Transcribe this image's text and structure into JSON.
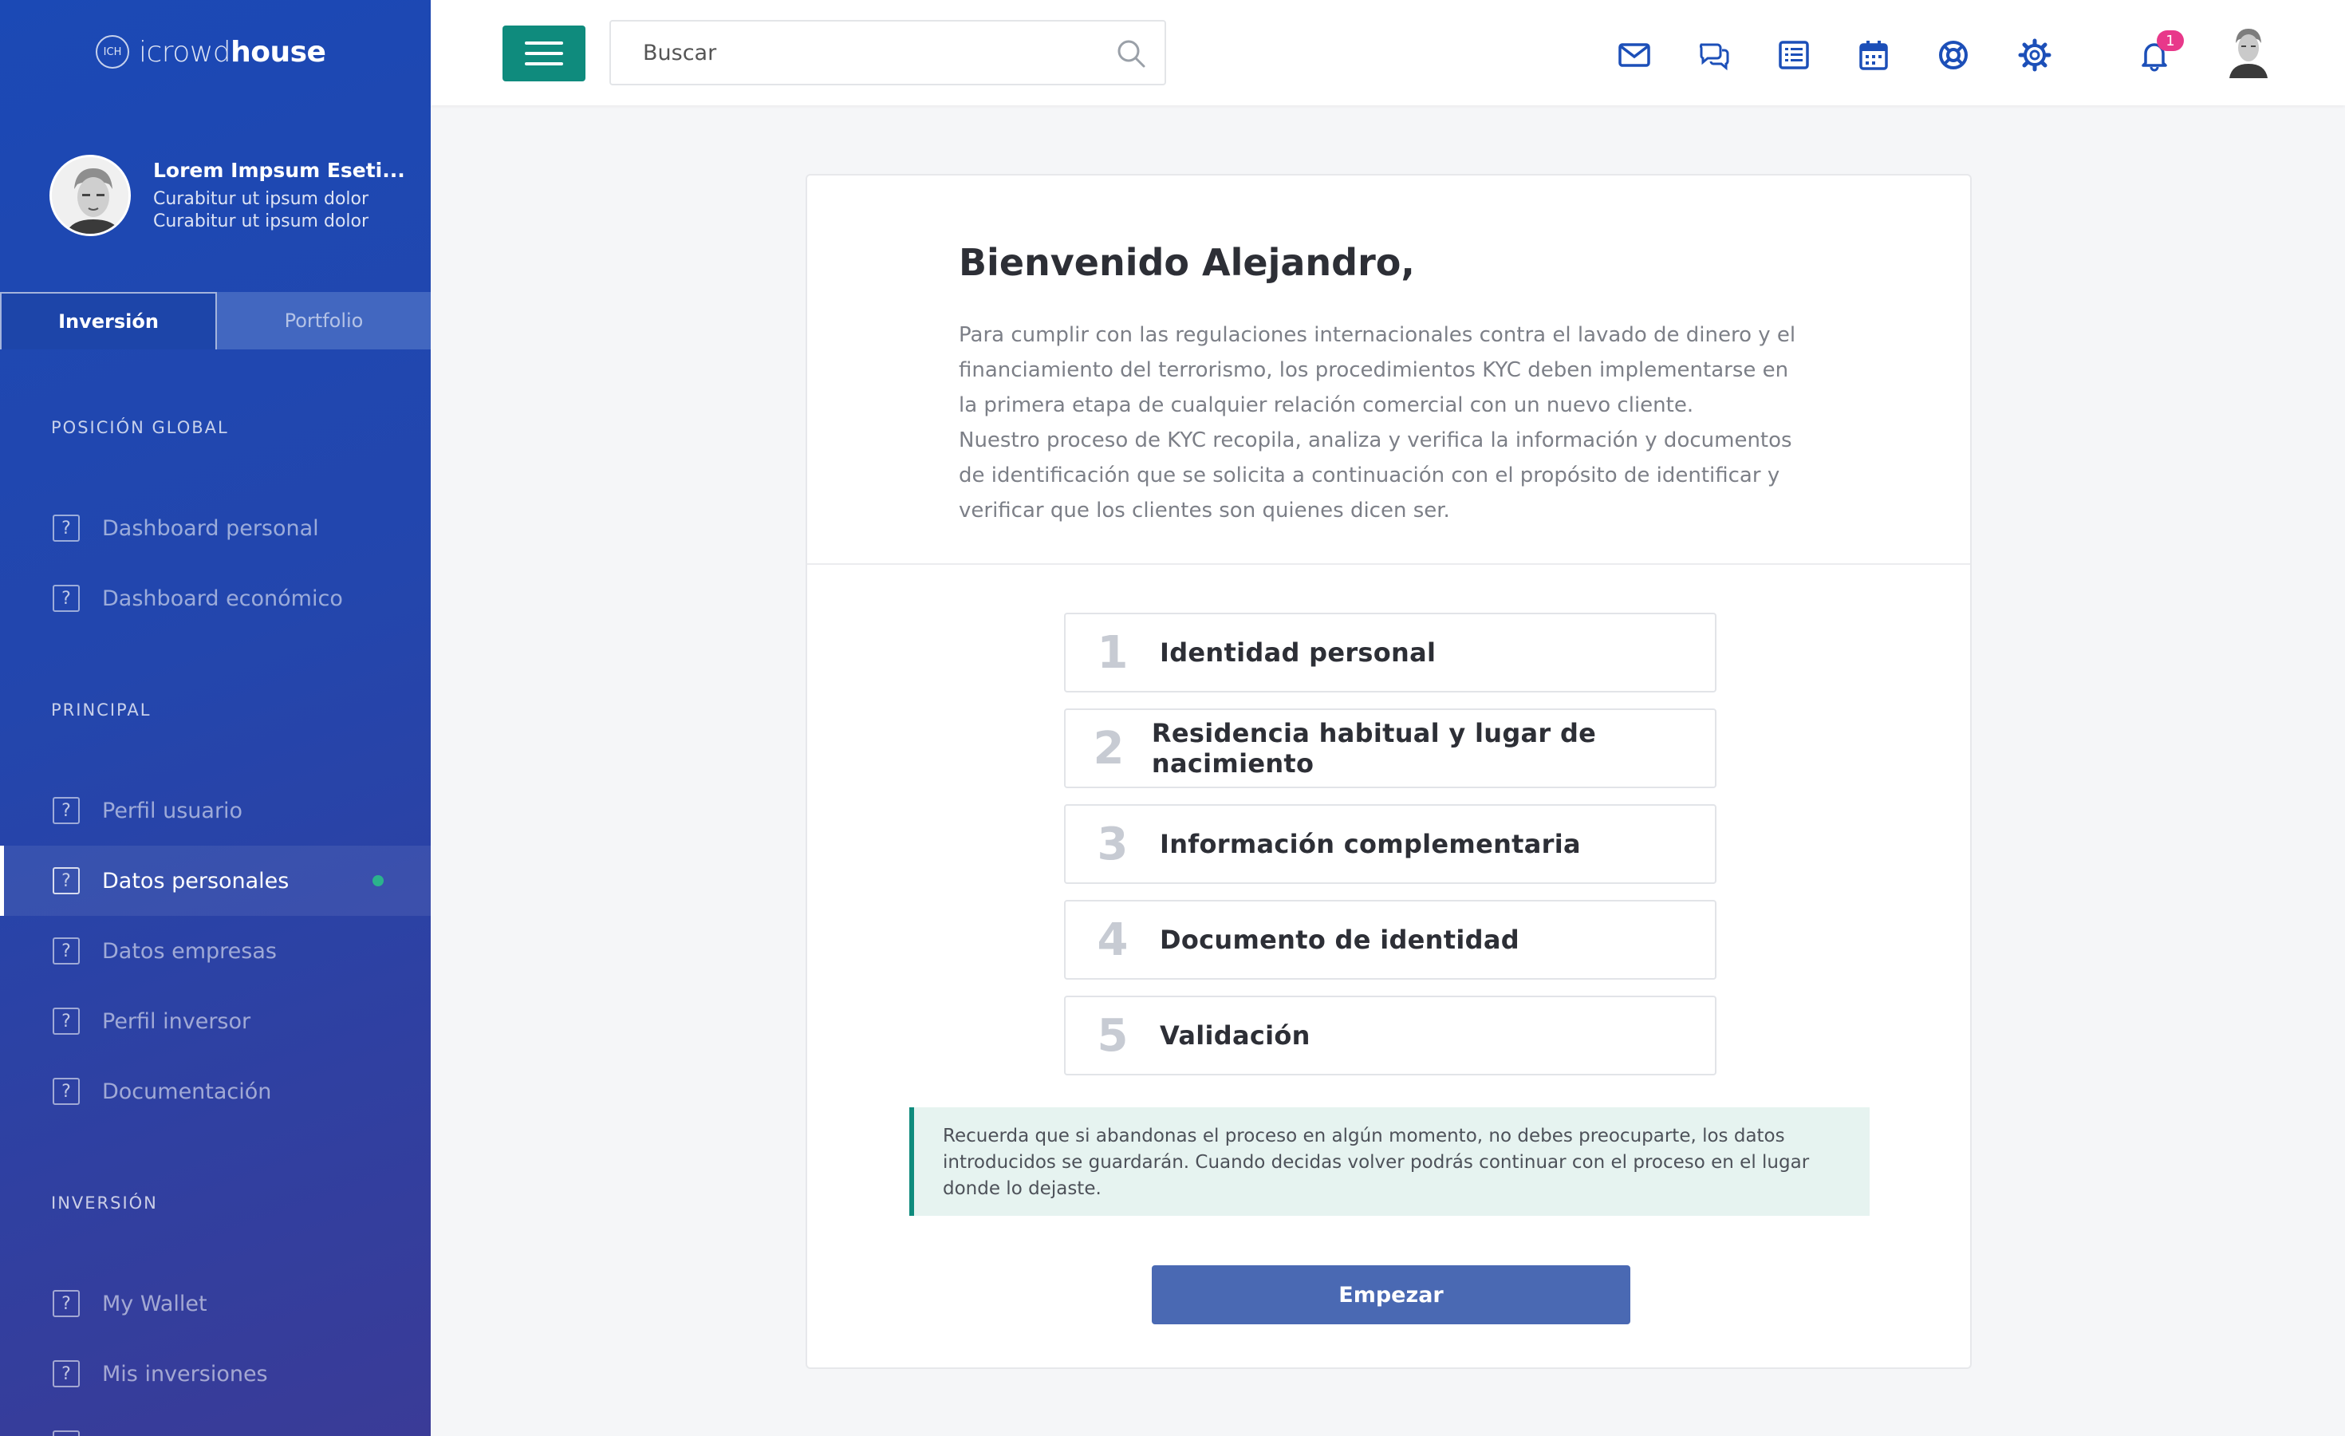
{
  "brand": {
    "logo_mark": "ICH",
    "name_light": "icrowd",
    "name_bold": "house"
  },
  "profile": {
    "name": "Lorem Impsum Eseti...",
    "line1": "Curabitur ut ipsum dolor",
    "line2": "Curabitur ut ipsum dolor"
  },
  "tabs": [
    {
      "label": "Inversión",
      "active": true
    },
    {
      "label": "Portfolio",
      "active": false
    }
  ],
  "sidebar": {
    "sections": [
      {
        "title": "POSICIÓN GLOBAL",
        "items": [
          {
            "label": "Dashboard personal",
            "icon": "help-box-icon"
          },
          {
            "label": "Dashboard económico",
            "icon": "help-box-icon"
          }
        ]
      },
      {
        "title": "PRINCIPAL",
        "items": [
          {
            "label": "Perfil usuario",
            "icon": "help-box-icon"
          },
          {
            "label": "Datos personales",
            "icon": "help-box-icon",
            "active": true,
            "status_dot_color": "#2bb38c"
          },
          {
            "label": "Datos empresas",
            "icon": "help-box-icon"
          },
          {
            "label": "Perfil inversor",
            "icon": "help-box-icon"
          },
          {
            "label": "Documentación",
            "icon": "help-box-icon"
          }
        ]
      },
      {
        "title": "INVERSIÓN",
        "items": [
          {
            "label": "My Wallet",
            "icon": "help-box-icon"
          },
          {
            "label": "Mis inversiones",
            "icon": "help-box-icon"
          }
        ]
      }
    ],
    "icon_glyph": "?"
  },
  "topbar": {
    "search_placeholder": "Buscar",
    "icons": [
      "mail-icon",
      "chat-icon",
      "list-icon",
      "calendar-icon",
      "support-icon",
      "settings-icon",
      "bell-icon"
    ],
    "notification_count": "1",
    "accent_color": "#0f8b7d",
    "icon_color": "#1c4fb8"
  },
  "main": {
    "title": "Bienvenido Alejandro,",
    "paragraph": [
      "Para cumplir con las regulaciones internacionales contra el lavado de dinero y el financiamiento del terrorismo, los procedimientos KYC deben implementarse en la primera etapa de cualquier relación comercial con un nuevo cliente.",
      "Nuestro proceso de KYC recopila, analiza y verifica la información y documentos de identificación que se solicita a continuación con el propósito de identificar y verificar que los clientes son quienes dicen ser."
    ],
    "steps": [
      {
        "num": "1",
        "label": "Identidad personal"
      },
      {
        "num": "2",
        "label": "Residencia habitual y lugar de nacimiento"
      },
      {
        "num": "3",
        "label": "Información complementaria"
      },
      {
        "num": "4",
        "label": "Documento de identidad"
      },
      {
        "num": "5",
        "label": "Validación"
      }
    ],
    "notice": " Recuerda que si abandonas el proceso en algún momento, no debes preocuparte, los datos introducidos se guardarán. Cuando decidas volver podrás continuar con el proceso en el lugar donde lo dejaste.",
    "start_button": "Empezar"
  }
}
